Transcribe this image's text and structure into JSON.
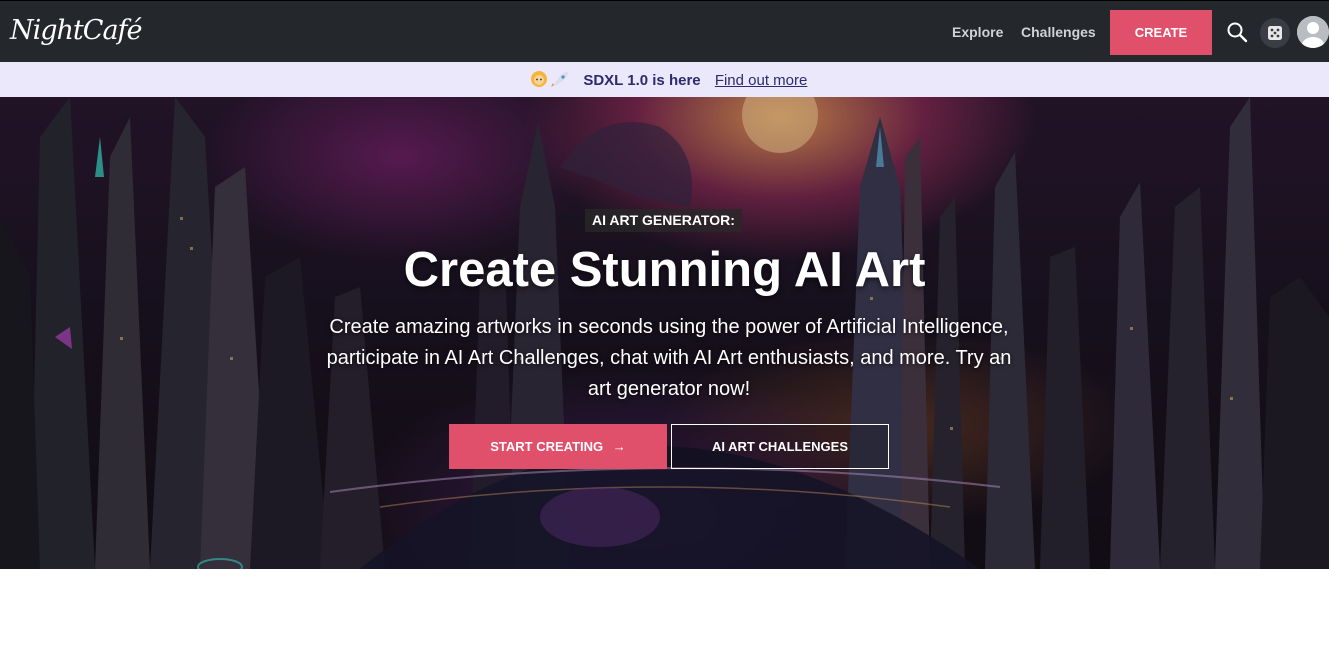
{
  "navbar": {
    "logo_text": "NightCafé",
    "links": {
      "explore": "Explore",
      "challenges": "Challenges"
    },
    "create_label": "CREATE",
    "icons": {
      "search": "search-icon",
      "random": "dice-icon",
      "avatar": "user-avatar"
    }
  },
  "banner": {
    "emoji": "🧑‍🚀",
    "headline": "SDXL 1.0 is here",
    "link_text": "Find out more"
  },
  "hero": {
    "eyebrow": "AI ART GENERATOR:",
    "title": "Create Stunning AI Art",
    "subtitle": "Create amazing artworks in seconds using the power of Artificial Intelligence, participate in AI Art Challenges, chat with AI Art enthusiasts, and more. Try an art generator now!",
    "start_label": "START CREATING",
    "start_arrow": "→",
    "challenges_label": "AI ART CHALLENGES"
  },
  "colors": {
    "navbar_bg": "#24272b",
    "accent": "#e0506b",
    "banner_bg": "#ebe8fb",
    "banner_text": "#2d2a6e"
  }
}
